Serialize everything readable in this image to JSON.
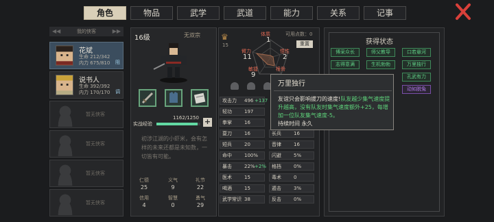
{
  "tabs": [
    "角色",
    "物品",
    "武学",
    "武道",
    "能力",
    "关系",
    "记事"
  ],
  "party_header": "我的侠客",
  "members": [
    {
      "name": "花斌",
      "hp": "生命 212/342",
      "mp": "内力 675/810",
      "badge": "阻"
    },
    {
      "name": "说书人",
      "hp": "生命 392/392",
      "mp": "内力 170/170",
      "badge": "调"
    }
  ],
  "empty_slot_text": "暂无侠客",
  "character": {
    "level": "16级",
    "sect": "无双宗",
    "xp_label": "实战经验",
    "xp_value": "1162/1250",
    "xp_fraction": 0.93,
    "bio": "初涉江湖的小虾米，会有怎样的未来还都是未知数，一切皆有可能。",
    "attrs": [
      {
        "name": "仁德",
        "value": "25"
      },
      {
        "name": "义气",
        "value": "9"
      },
      {
        "name": "礼节",
        "value": "22"
      },
      {
        "name": "信用",
        "value": "4"
      },
      {
        "name": "智慧",
        "value": "0"
      },
      {
        "name": "勇气",
        "value": "29"
      }
    ]
  },
  "radar": {
    "labels": {
      "top": "体质",
      "left": "臂力",
      "right": "悟性",
      "bottom": "敏捷",
      "bottom2": "根骨"
    },
    "values": {
      "top": "1",
      "left": "11",
      "right": "2",
      "bottom": "9"
    },
    "medal_count": "15",
    "points": "可用点数：0",
    "reset": "重置"
  },
  "stats_left": [
    {
      "name": "攻击力",
      "value": "496",
      "bonus": "+137"
    },
    {
      "name": "轻功",
      "value": "197",
      "bonus": ""
    },
    {
      "name": "拳掌",
      "value": "16",
      "bonus": ""
    },
    {
      "name": "耍刀",
      "value": "16",
      "bonus": ""
    },
    {
      "name": "短兵",
      "value": "20",
      "bonus": ""
    },
    {
      "name": "命中",
      "value": "100%",
      "bonus": ""
    },
    {
      "name": "暴击",
      "value": "22%",
      "bonus": "+2%"
    },
    {
      "name": "医术",
      "value": "15",
      "bonus": ""
    },
    {
      "name": "喝酒",
      "value": "15",
      "bonus": ""
    },
    {
      "name": "武学常识",
      "value": "38",
      "bonus": ""
    }
  ],
  "stats_right": [
    {
      "name": "长兵",
      "value": "16"
    },
    {
      "name": "音律",
      "value": "16"
    },
    {
      "name": "闪避",
      "value": "5%"
    },
    {
      "name": "格挡",
      "value": "0%"
    },
    {
      "name": "毒术",
      "value": "0"
    },
    {
      "name": "遁击",
      "value": "3%"
    },
    {
      "name": "反击",
      "value": "0%"
    }
  ],
  "status": {
    "title": "获得状态",
    "chips": [
      "博采众长",
      "师父教导",
      "口若悬河",
      "志得意满",
      "生机勃勃",
      "万里独行",
      "",
      "",
      "孔武有力",
      "",
      "",
      "动如脱兔"
    ]
  },
  "popup": {
    "title": "万里独行",
    "body_plain": "友谊只会影响拔刀的速度!",
    "body_green": "队友越少集气速度提升越高，没有队友时集气速度额外+25，每增加一位队友集气速度-5。",
    "duration": "持续时间  永久"
  }
}
